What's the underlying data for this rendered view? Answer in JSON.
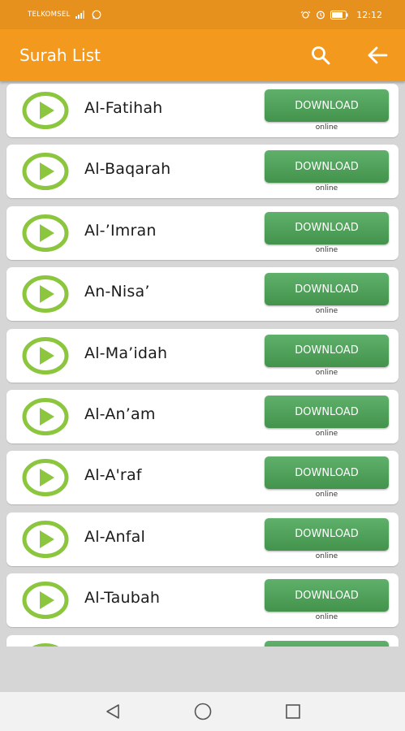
{
  "status_bar": {
    "carrier": "TELKOMSEL",
    "time": "12:12"
  },
  "app_bar": {
    "title": "Surah List",
    "search_icon": "search-icon",
    "back_icon": "arrow-back-icon"
  },
  "colors": {
    "status_bar": "#e6901e",
    "app_bar": "#f39a1e",
    "play_accent": "#8cc63f",
    "download_button": "#4e9f57",
    "background": "#d6d6d6"
  },
  "surahs": [
    {
      "name": "Al-Fatihah",
      "button": "DOWNLOAD",
      "status": "online"
    },
    {
      "name": "Al-Baqarah",
      "button": "DOWNLOAD",
      "status": "online"
    },
    {
      "name": "Al-’Imran",
      "button": "DOWNLOAD",
      "status": "online"
    },
    {
      "name": "An-Nisa’",
      "button": "DOWNLOAD",
      "status": "online"
    },
    {
      "name": "Al-Ma’idah",
      "button": "DOWNLOAD",
      "status": "online"
    },
    {
      "name": "Al-An’am",
      "button": "DOWNLOAD",
      "status": "online"
    },
    {
      "name": "Al-A'raf",
      "button": "DOWNLOAD",
      "status": "online"
    },
    {
      "name": "Al-Anfal",
      "button": "DOWNLOAD",
      "status": "online"
    },
    {
      "name": "Al-Taubah",
      "button": "DOWNLOAD",
      "status": "online"
    }
  ],
  "nav_bar": {
    "back_icon": "nav-back-icon",
    "home_icon": "nav-home-icon",
    "recents_icon": "nav-recents-icon"
  }
}
